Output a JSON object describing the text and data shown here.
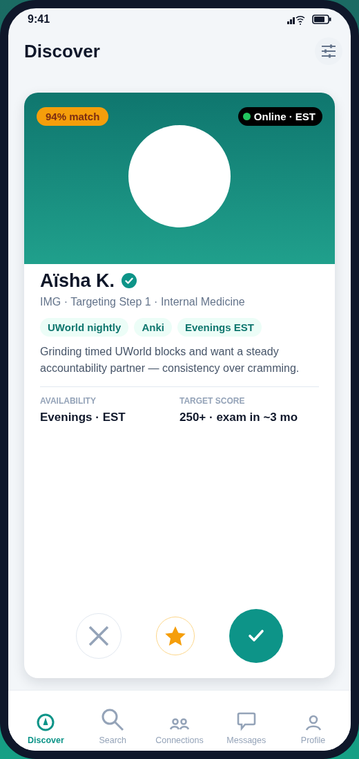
{
  "status_bar": {
    "time": "9:41"
  },
  "header": {
    "title": "Discover"
  },
  "card": {
    "match": "94% match",
    "presence": {
      "label": "Online · EST",
      "online": true
    },
    "name": "Aïsha K.",
    "verified": true,
    "subtitle": "IMG · Targeting Step 1 · Internal Medicine",
    "tags": [
      "UWorld nightly",
      "Anki",
      "Evenings EST"
    ],
    "bio": "Grinding timed UWorld blocks and want a steady accountability partner — consistency over cramming.",
    "facts": [
      {
        "label": "AVAILABILITY",
        "value": "Evenings · EST"
      },
      {
        "label": "TARGET SCORE",
        "value": "250+ · exam in ~3 mo"
      }
    ]
  },
  "actions": [
    {
      "kind": "pass"
    },
    {
      "kind": "star"
    },
    {
      "kind": "like"
    }
  ],
  "nav": [
    {
      "kind": "discover",
      "label": "Discover",
      "selected": true
    },
    {
      "kind": "search",
      "label": "Search",
      "selected": false
    },
    {
      "kind": "connections",
      "label": "Connections",
      "selected": false
    },
    {
      "kind": "messages",
      "label": "Messages",
      "selected": false
    },
    {
      "kind": "profile",
      "label": "Profile",
      "selected": false
    }
  ]
}
